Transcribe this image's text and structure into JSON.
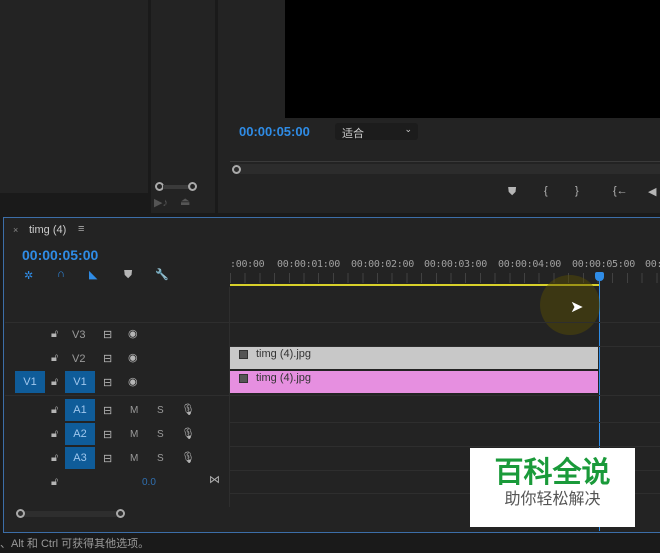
{
  "program_monitor": {
    "timecode": "00:00:05:00",
    "fit_select": "适合"
  },
  "timeline": {
    "sequence_name": "timg (4)",
    "timecode": "00:00:05:00",
    "ruler_labels": [
      ":00:00",
      "00:00:01:00",
      "00:00:02:00",
      "00:00:03:00",
      "00:00:04:00",
      "00:00:05:00",
      "00:"
    ],
    "video_tracks": [
      {
        "label": "V3"
      },
      {
        "label": "V2"
      },
      {
        "label": "V1",
        "source": "V1"
      }
    ],
    "audio_tracks": [
      {
        "label": "A1"
      },
      {
        "label": "A2"
      },
      {
        "label": "A3"
      }
    ],
    "mute_label": "M",
    "solo_label": "S",
    "master_volume": "0.0",
    "clips": [
      {
        "name": "timg (4).jpg",
        "track": "V2",
        "color": "#c8c8c8"
      },
      {
        "name": "timg (4).jpg",
        "track": "V1",
        "color": "#e68fe0"
      }
    ]
  },
  "status_bar": "、Alt 和 Ctrl 可获得其他选项。",
  "watermark": {
    "title": "百科全说",
    "subtitle": "助你轻松解决"
  },
  "colors": {
    "accent": "#2f8ce6",
    "work_area": "#d8d02a"
  }
}
